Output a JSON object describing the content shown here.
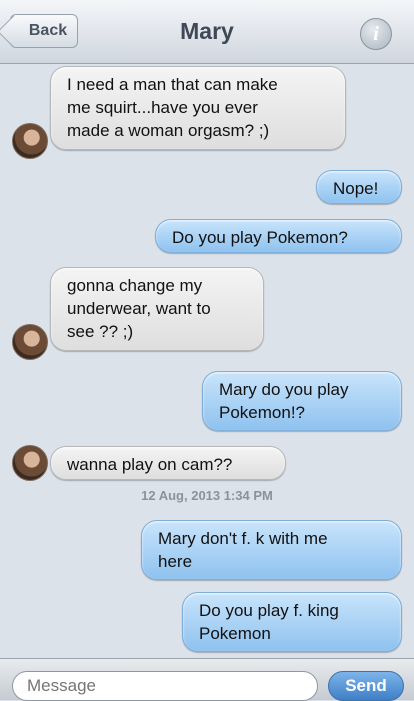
{
  "header": {
    "back_label": "Back",
    "title": "Mary",
    "info_icon": "info-icon"
  },
  "messages": [
    {
      "from": "Mary",
      "direction": "incoming",
      "text": "I need a man that can make\nme squirt...have you ever\nmade a woman orgasm? ;)"
    },
    {
      "from": "me",
      "direction": "outgoing",
      "text": "Nope!"
    },
    {
      "from": "me",
      "direction": "outgoing",
      "text": "Do you play Pokemon?"
    },
    {
      "from": "Mary",
      "direction": "incoming",
      "text": "gonna change my\nunderwear, want to\nsee ?? ;)"
    },
    {
      "from": "me",
      "direction": "outgoing",
      "text": "Mary do you play\nPokemon!?"
    },
    {
      "from": "Mary",
      "direction": "incoming",
      "text": "wanna play on cam??"
    },
    {
      "from": "me",
      "direction": "outgoing",
      "text": "Mary don't f.  k with me\nhere"
    },
    {
      "from": "me",
      "direction": "outgoing",
      "text": "Do you play f. king\nPokemon"
    }
  ],
  "timestamp": "12 Aug, 2013 1:34 PM",
  "composer": {
    "placeholder": "Message",
    "send_label": "Send"
  },
  "colors": {
    "incoming_bubble": "#e6e6e6",
    "outgoing_bubble": "#a9d2f5",
    "background": "#dbe2ea",
    "send_button": "#3f7fc6"
  }
}
